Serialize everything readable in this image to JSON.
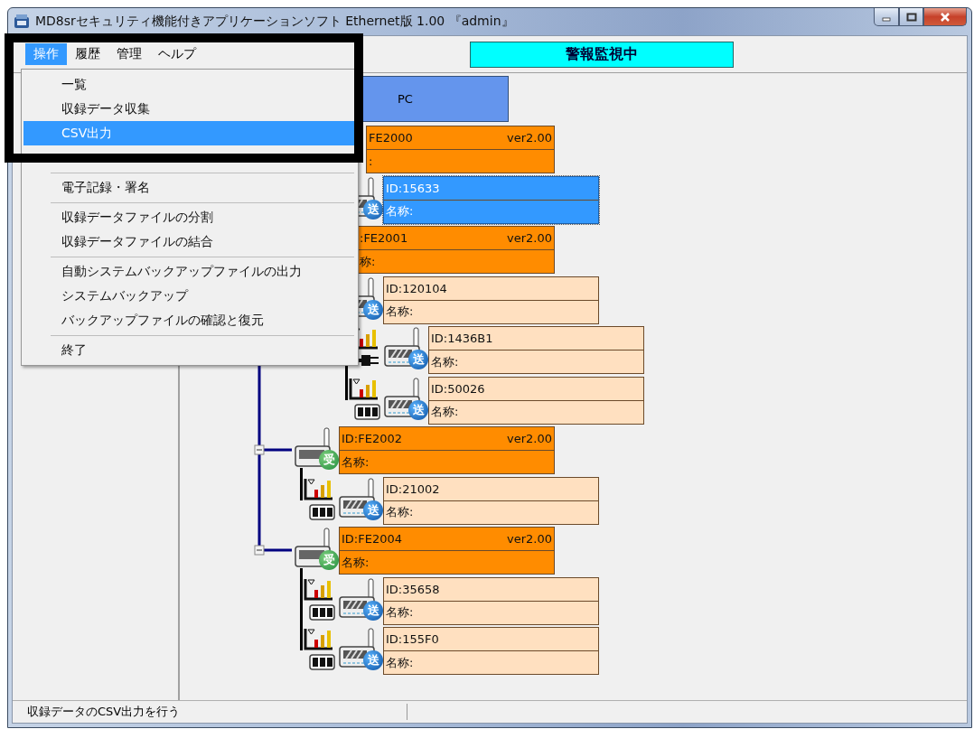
{
  "window": {
    "title": "MD8srセキュリティ機能付きアプリケーションソフト Ethernet版 1.00 『admin』"
  },
  "menubar": [
    {
      "label": "操作",
      "selected": true
    },
    {
      "label": "履歴",
      "selected": false
    },
    {
      "label": "管理",
      "selected": false
    },
    {
      "label": "ヘルプ",
      "selected": false
    }
  ],
  "menu": {
    "open": true,
    "items": [
      {
        "kind": "item",
        "label": "一覧",
        "selected": false
      },
      {
        "kind": "item",
        "label": "収録データ収集",
        "selected": false
      },
      {
        "kind": "item",
        "label": "CSV出力",
        "selected": true
      },
      {
        "kind": "covered"
      },
      {
        "kind": "separator"
      },
      {
        "kind": "item",
        "label": "電子記録・署名",
        "selected": false
      },
      {
        "kind": "separator"
      },
      {
        "kind": "item",
        "label": "収録データファイルの分割",
        "selected": false
      },
      {
        "kind": "item",
        "label": "収録データファイルの結合",
        "selected": false
      },
      {
        "kind": "separator"
      },
      {
        "kind": "item",
        "label": "自動システムバックアップファイルの出力",
        "selected": false
      },
      {
        "kind": "item",
        "label": "システムバックアップ",
        "selected": false
      },
      {
        "kind": "item",
        "label": "バックアップファイルの確認と復元",
        "selected": false
      },
      {
        "kind": "separator"
      },
      {
        "kind": "item",
        "label": "終了",
        "selected": false
      }
    ]
  },
  "status_banner": "警報監視中",
  "network": {
    "pc": {
      "label": "PC"
    },
    "nodes": [
      {
        "kind": "gateway",
        "id": "FE2000",
        "version": "ver2.00",
        "name": ":",
        "selected": false,
        "children": [
          {
            "kind": "sensor",
            "id": "ID:15633",
            "name": "名称:",
            "mark": "送",
            "selected": true
          }
        ]
      },
      {
        "kind": "gateway",
        "id": ":FE2001",
        "version": "ver2.00",
        "name": "称:",
        "selected": false,
        "children": [
          {
            "kind": "sensor",
            "id": "ID:120104",
            "name": "名称:",
            "mark": "送",
            "selected": false,
            "children": [
              {
                "kind": "sensor_ac",
                "id": "ID:1436B1",
                "name": "名称:",
                "mark": "送",
                "selected": false
              },
              {
                "kind": "sensor_battery",
                "id": "ID:50026",
                "name": "名称:",
                "mark": "送",
                "selected": false
              }
            ]
          }
        ]
      },
      {
        "kind": "gateway",
        "id": "ID:FE2002",
        "version": "ver2.00",
        "name": "名称:",
        "mark": "受",
        "selected": false,
        "children": [
          {
            "kind": "sensor_battery",
            "id": "ID:21002",
            "name": "名称:",
            "mark": "送",
            "selected": false
          }
        ]
      },
      {
        "kind": "gateway",
        "id": "ID:FE2004",
        "version": "ver2.00",
        "name": "名称:",
        "mark": "受",
        "selected": false,
        "children": [
          {
            "kind": "sensor_battery",
            "id": "ID:35658",
            "name": "名称:",
            "mark": "送",
            "selected": false
          },
          {
            "kind": "sensor_battery",
            "id": "ID:155F0",
            "name": "名称:",
            "mark": "送",
            "selected": false
          }
        ]
      }
    ]
  },
  "status_bar": {
    "text": "収録データのCSV出力を行う"
  }
}
